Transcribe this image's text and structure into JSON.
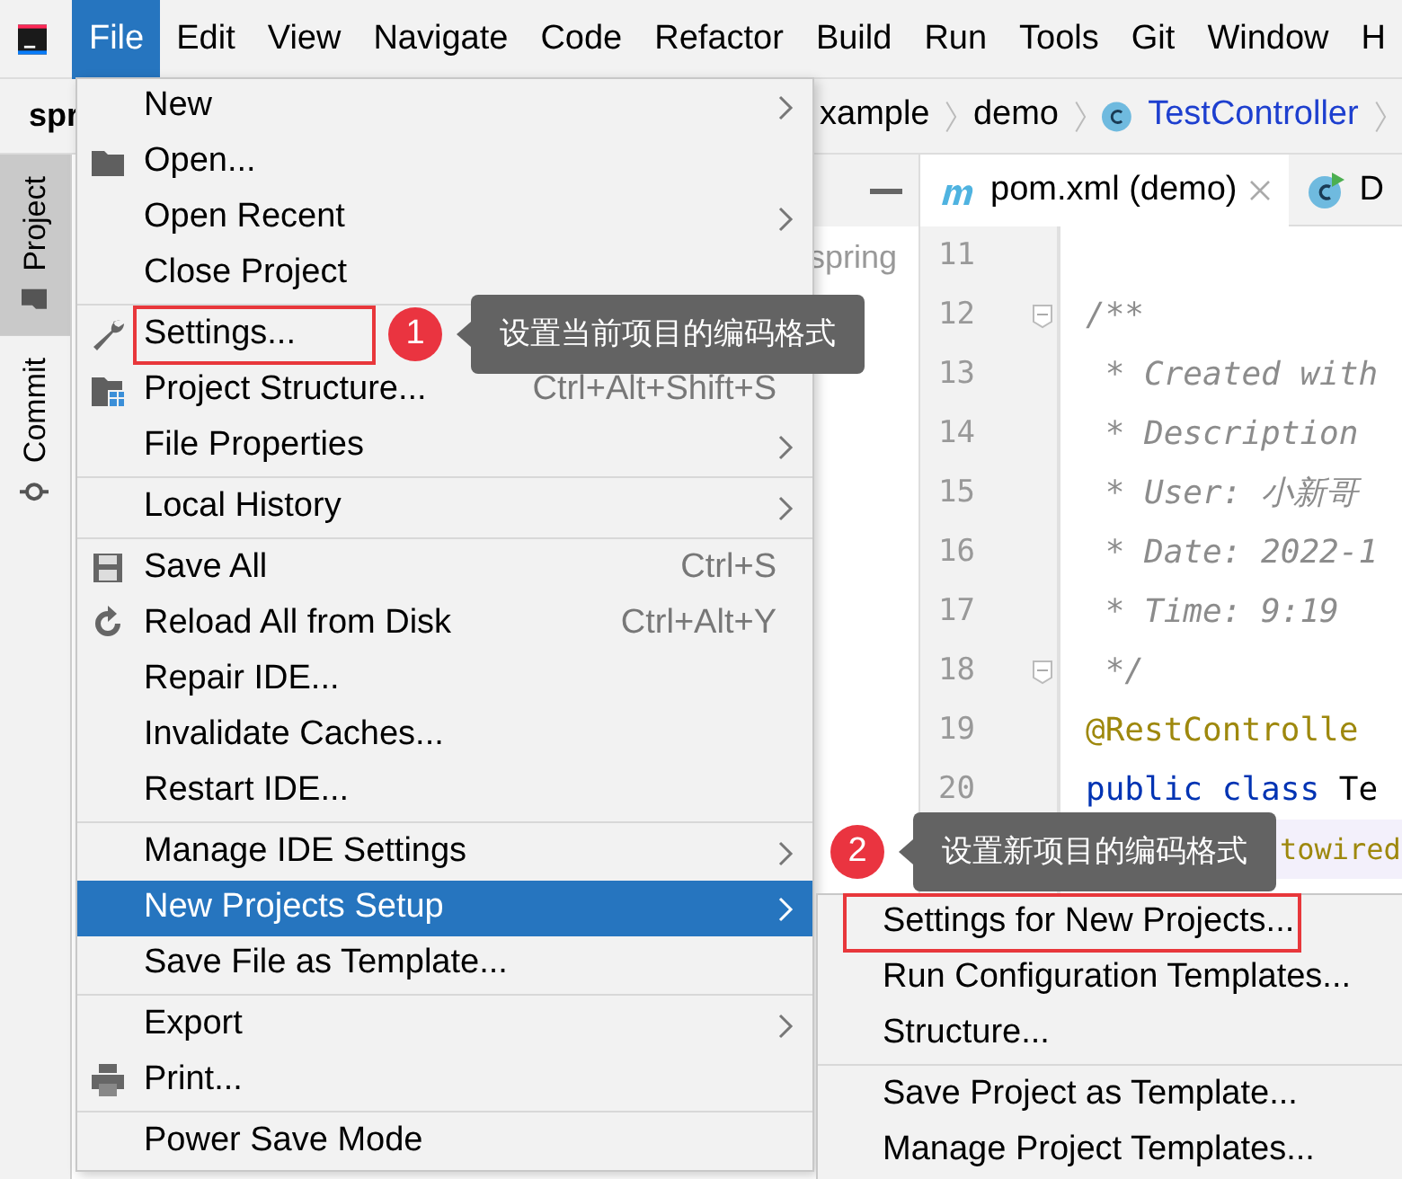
{
  "menu_bar": [
    {
      "label": "File",
      "selected": true
    },
    {
      "label": "Edit",
      "selected": false
    },
    {
      "label": "View",
      "selected": false
    },
    {
      "label": "Navigate",
      "selected": false
    },
    {
      "label": "Code",
      "selected": false
    },
    {
      "label": "Refactor",
      "selected": false
    },
    {
      "label": "Build",
      "selected": false
    },
    {
      "label": "Run",
      "selected": false
    },
    {
      "label": "Tools",
      "selected": false
    },
    {
      "label": "Git",
      "selected": false
    },
    {
      "label": "Window",
      "selected": false
    },
    {
      "label": "H",
      "selected": false
    }
  ],
  "toolbar": {
    "project": "spr",
    "breadcrumbs": [
      {
        "label": "xample",
        "kind": "text"
      },
      {
        "label": "demo",
        "kind": "text"
      },
      {
        "label": "TestController",
        "kind": "class"
      }
    ]
  },
  "side_tabs": [
    {
      "label": "Project",
      "selected": true,
      "kind": "folder"
    },
    {
      "label": "Commit",
      "selected": false,
      "kind": "commit"
    }
  ],
  "project_tree": {
    "fragment": "spring"
  },
  "editor": {
    "tabs": [
      {
        "label": "pom.xml (demo)",
        "kind": "maven",
        "selected": true
      },
      {
        "label": "D",
        "kind": "class",
        "selected": false
      }
    ],
    "lines": [
      {
        "number": "11"
      },
      {
        "number": "12",
        "fold": true,
        "tokens": [
          {
            "text": "/**",
            "kind": "comment"
          }
        ]
      },
      {
        "number": "13",
        "tokens": [
          {
            "text": " * Created with",
            "kind": "comment"
          }
        ]
      },
      {
        "number": "14",
        "tokens": [
          {
            "text": " * Description",
            "kind": "comment"
          }
        ]
      },
      {
        "number": "15",
        "tokens": [
          {
            "text": " * User: 小新哥",
            "kind": "comment"
          }
        ]
      },
      {
        "number": "16",
        "tokens": [
          {
            "text": " * Date: 2022-1",
            "kind": "comment"
          }
        ]
      },
      {
        "number": "17",
        "tokens": [
          {
            "text": " * Time: 9:19",
            "kind": "comment"
          }
        ]
      },
      {
        "number": "18",
        "fold": true,
        "tokens": [
          {
            "text": " */",
            "kind": "comment"
          }
        ]
      },
      {
        "number": "19",
        "tokens": [
          {
            "text": "@RestControlle",
            "kind": "annotation"
          }
        ]
      },
      {
        "number": "20",
        "tokens": [
          {
            "text": "public class",
            "kind": "keyword"
          },
          {
            "text": " Te",
            "kind": "plain"
          }
        ]
      }
    ],
    "hidden_line_tail": "towired"
  },
  "file_menu": [
    {
      "label": "New",
      "kind": "submenu"
    },
    {
      "label": "Open...",
      "kind": "item"
    },
    {
      "label": "Open Recent",
      "kind": "submenu"
    },
    {
      "label": "Close Project",
      "kind": "item"
    },
    {
      "kind": "separator"
    },
    {
      "label": "Settings...",
      "kind": "item",
      "highlight": true
    },
    {
      "label": "Project Structure...",
      "kind": "item",
      "shortcut": "Ctrl+Alt+Shift+S"
    },
    {
      "label": "File Properties",
      "kind": "submenu"
    },
    {
      "kind": "separator"
    },
    {
      "label": "Local History",
      "kind": "submenu"
    },
    {
      "kind": "separator"
    },
    {
      "label": "Save All",
      "kind": "item",
      "shortcut": "Ctrl+S"
    },
    {
      "label": "Reload All from Disk",
      "kind": "item",
      "shortcut": "Ctrl+Alt+Y"
    },
    {
      "label": "Repair IDE...",
      "kind": "item"
    },
    {
      "label": "Invalidate Caches...",
      "kind": "item"
    },
    {
      "label": "Restart IDE...",
      "kind": "item"
    },
    {
      "kind": "separator"
    },
    {
      "label": "Manage IDE Settings",
      "kind": "submenu"
    },
    {
      "label": "New Projects Setup",
      "kind": "submenu",
      "selected": true
    },
    {
      "label": "Save File as Template...",
      "kind": "item"
    },
    {
      "kind": "separator"
    },
    {
      "label": "Export",
      "kind": "submenu"
    },
    {
      "label": "Print...",
      "kind": "item"
    },
    {
      "kind": "separator"
    },
    {
      "label": "Power Save Mode",
      "kind": "item"
    }
  ],
  "submenu": [
    {
      "label": "Settings for New Projects...",
      "kind": "item",
      "highlight": true
    },
    {
      "label": "Run Configuration Templates...",
      "kind": "item"
    },
    {
      "label": "Structure...",
      "kind": "item"
    },
    {
      "kind": "separator"
    },
    {
      "label": "Save Project as Template...",
      "kind": "item"
    },
    {
      "label": "Manage Project Templates...",
      "kind": "item"
    }
  ],
  "callouts": [
    {
      "number": "1",
      "text": "设置当前项目的编码格式"
    },
    {
      "number": "2",
      "text": "设置新项目的编码格式"
    }
  ]
}
